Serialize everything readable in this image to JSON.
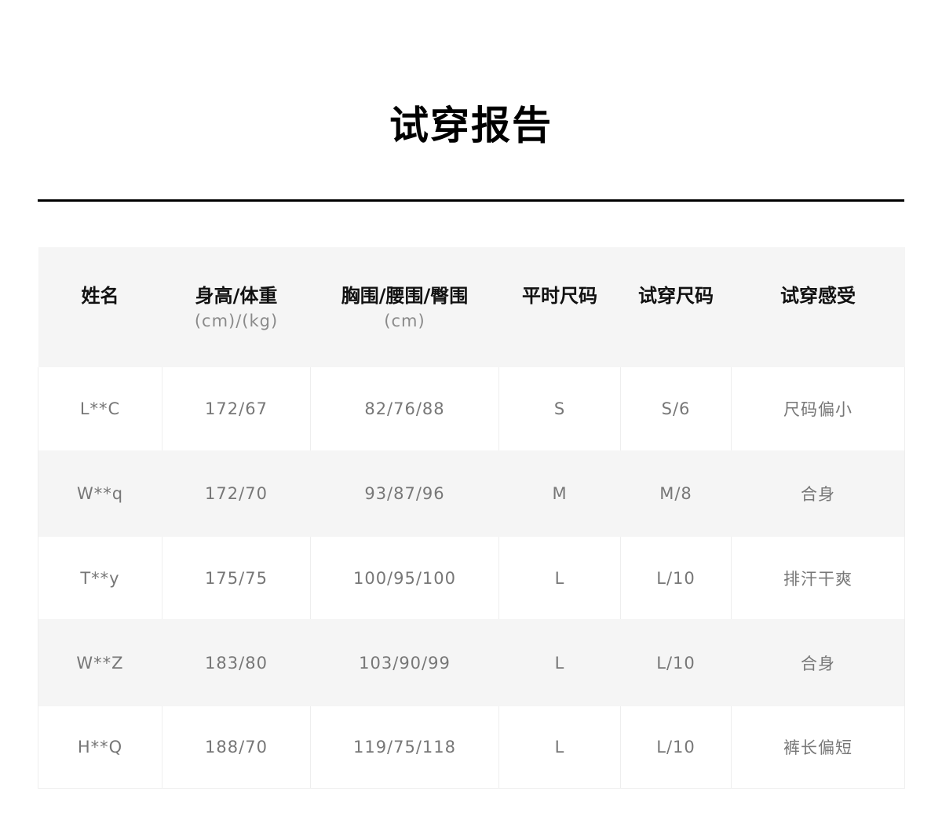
{
  "title": "试穿报告",
  "table": {
    "headers": [
      {
        "label": "姓名",
        "unit": ""
      },
      {
        "label": "身高/体重",
        "unit": "(cm)/(kg)"
      },
      {
        "label": "胸围/腰围/臀围",
        "unit": "(cm)"
      },
      {
        "label": "平时尺码",
        "unit": ""
      },
      {
        "label": "试穿尺码",
        "unit": ""
      },
      {
        "label": "试穿感受",
        "unit": ""
      }
    ],
    "rows": [
      [
        "L**C",
        "172/67",
        "82/76/88",
        "S",
        "S/6",
        "尺码偏小"
      ],
      [
        "W**q",
        "172/70",
        "93/87/96",
        "M",
        "M/8",
        "合身"
      ],
      [
        "T**y",
        "175/75",
        "100/95/100",
        "L",
        "L/10",
        "排汗干爽"
      ],
      [
        "W**Z",
        "183/80",
        "103/90/99",
        "L",
        "L/10",
        "合身"
      ],
      [
        "H**Q",
        "188/70",
        "119/75/118",
        "L",
        "L/10",
        "裤长偏短"
      ]
    ]
  },
  "colors": {
    "header_bg": "#f5f5f5",
    "row_alt_bg": "#f5f5f5",
    "text_header": "#111111",
    "text_cell": "#777777",
    "divider": "#000000"
  }
}
